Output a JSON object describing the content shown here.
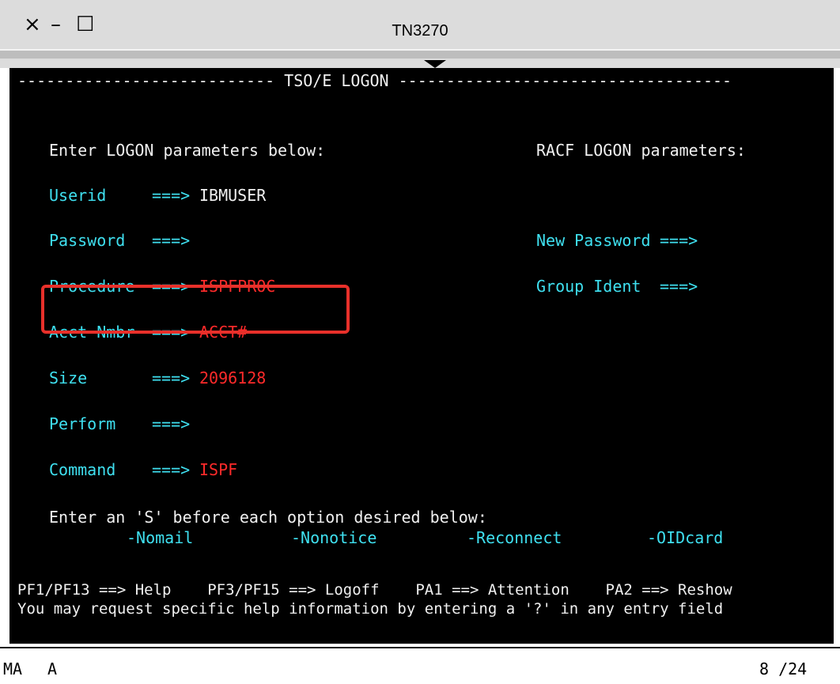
{
  "window": {
    "title": "TN3270",
    "controls": {
      "close": "×",
      "minimize": "–",
      "maximize": "☐"
    }
  },
  "screen": {
    "header_line": "--------------------------- TSO/E LOGON -----------------------------------",
    "left_heading": "Enter LOGON parameters below:",
    "right_heading": "RACF LOGON parameters:",
    "fields": {
      "userid": {
        "label": "Userid",
        "arrow": "===>",
        "value": "IBMUSER"
      },
      "password": {
        "label": "Password",
        "arrow": "===>",
        "value": ""
      },
      "procedure": {
        "label": "Procedure",
        "arrow": "===>",
        "value": "ISPFPROC"
      },
      "acct": {
        "label": "Acct Nmbr",
        "arrow": "===>",
        "value": "ACCT#"
      },
      "size": {
        "label": "Size",
        "arrow": "===>",
        "value": "2096128"
      },
      "perform": {
        "label": "Perform",
        "arrow": "===>",
        "value": ""
      },
      "command": {
        "label": "Command",
        "arrow": "===>",
        "value": "ISPF"
      },
      "new_password": {
        "label": "New Password",
        "arrow": "===>",
        "value": ""
      },
      "group_ident": {
        "label": "Group Ident",
        "arrow": "===>",
        "value": ""
      }
    },
    "options_instruction": "Enter an 'S' before each option desired below:",
    "options": [
      "-Nomail",
      "-Nonotice",
      "-Reconnect",
      "-OIDcard"
    ],
    "pf_line": "PF1/PF13 ==> Help    PF3/PF15 ==> Logoff    PA1 ==> Attention    PA2 ==> Reshow",
    "help_line": "You may request specific help information by entering a '?' in any entry field"
  },
  "status": {
    "left1": "MA",
    "left2": "A",
    "cursor_pos": "8 /24"
  },
  "colors": {
    "background": "#000000",
    "label": "#3fe0f0",
    "value_protected": "#ff2a2a",
    "text": "#f0f0f0",
    "highlight": "#e8302a"
  }
}
